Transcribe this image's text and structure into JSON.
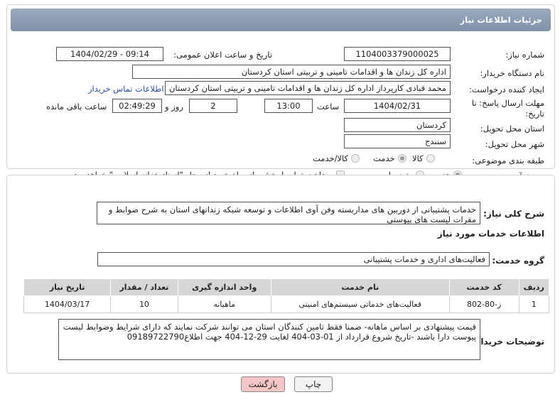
{
  "header": {
    "title": "جزئیات اطلاعات نیاز"
  },
  "need_number": {
    "label": "شماره نیاز:",
    "value": "1104003379000025"
  },
  "announce": {
    "label": "تاریخ و ساعت اعلان عمومی:",
    "value": "1404/02/29 - 09:14"
  },
  "buyer_org": {
    "label": "نام دستگاه خریدار:",
    "value": "اداره کل زندان ها و اقدامات تامینی و تربیتی استان کردستان"
  },
  "requester": {
    "label": "ایجاد کننده درخواست:",
    "value": "محمد  قبادی کارپرداز اداره کل زندان ها و اقدامات تامینی و تربیتی استان کردستان",
    "contact_link": "اطلاعات تماس خریدار"
  },
  "deadline": {
    "label": "مهلت ارسال پاسخ: تا تاریخ:",
    "date": "1404/02/31",
    "time_label": "ساعت",
    "time": "13:00",
    "days": "2",
    "days_label": "روز و",
    "remaining": "02:49:29",
    "remaining_label": "ساعت باقی مانده"
  },
  "province": {
    "label": "استان محل تحویل:",
    "value": "کردستان"
  },
  "city": {
    "label": "شهر محل تحویل:",
    "value": "سنندج"
  },
  "category": {
    "label": "طبقه بندی موضوعی:",
    "options": [
      "کالا",
      "خدمت",
      "کالا/خدمت"
    ],
    "selected": "خدمت"
  },
  "purchase_type": {
    "label": "نوع فرآیند خرید :",
    "options": [
      "جزیی",
      "متوسط"
    ],
    "selected": "جزیی",
    "note": "پرداخت تمام یا بخشی از مبلغ خرید،از محل \"اسناد خزانه اسلامی\" خواهد بود."
  },
  "summary": {
    "label": "شرح کلی نیاز:",
    "text": "خدمات پشتیبانی از دوربین های مداربسته وفن آوی اطلاعات  و توسعه شبکه   زندانهای استان به شرح ضوابط و مقرات لیست های پیوستی"
  },
  "services_title": "اطلاعات خدمات مورد نیاز",
  "service_group": {
    "label": "گروه خدمت:",
    "value": "فعالیت‌های اداری و خدمات پشتیبانی"
  },
  "table": {
    "headers": [
      "ردیف",
      "کد خدمت",
      "نام خدمت",
      "واحد اندازه گیری",
      "تعداد / مقدار",
      "تاریخ نیاز"
    ],
    "rows": [
      [
        "1",
        "ز-80-802",
        "فعالیت‌های خدماتی سیستم‌های امنیتی",
        "ماهیانه",
        "10",
        "1404/03/17"
      ]
    ]
  },
  "buyer_notes": {
    "label": "توضیحات خریدار:",
    "text": "قیمت پیشنهادی  بر اساس  ماهانه-  ضمنا فقط تامین  کنندگان استان  می توانند شرکت  نمایند که دارای شرایط وضوابط لیست پیوست دارا باشند  -تاریخ شروع قرارداد از 01-03-404 لغایت 29-12-404  جهت اطلاع09189722790"
  },
  "buttons": {
    "print": "چاپ",
    "back": "بازگشت"
  },
  "watermark": "AriaTender.neT",
  "colors": {
    "header_bg": "#8797ae",
    "back_btn_bg": "#f4c6c6",
    "link": "#2a4ea0",
    "watermark": "#c0392b"
  }
}
